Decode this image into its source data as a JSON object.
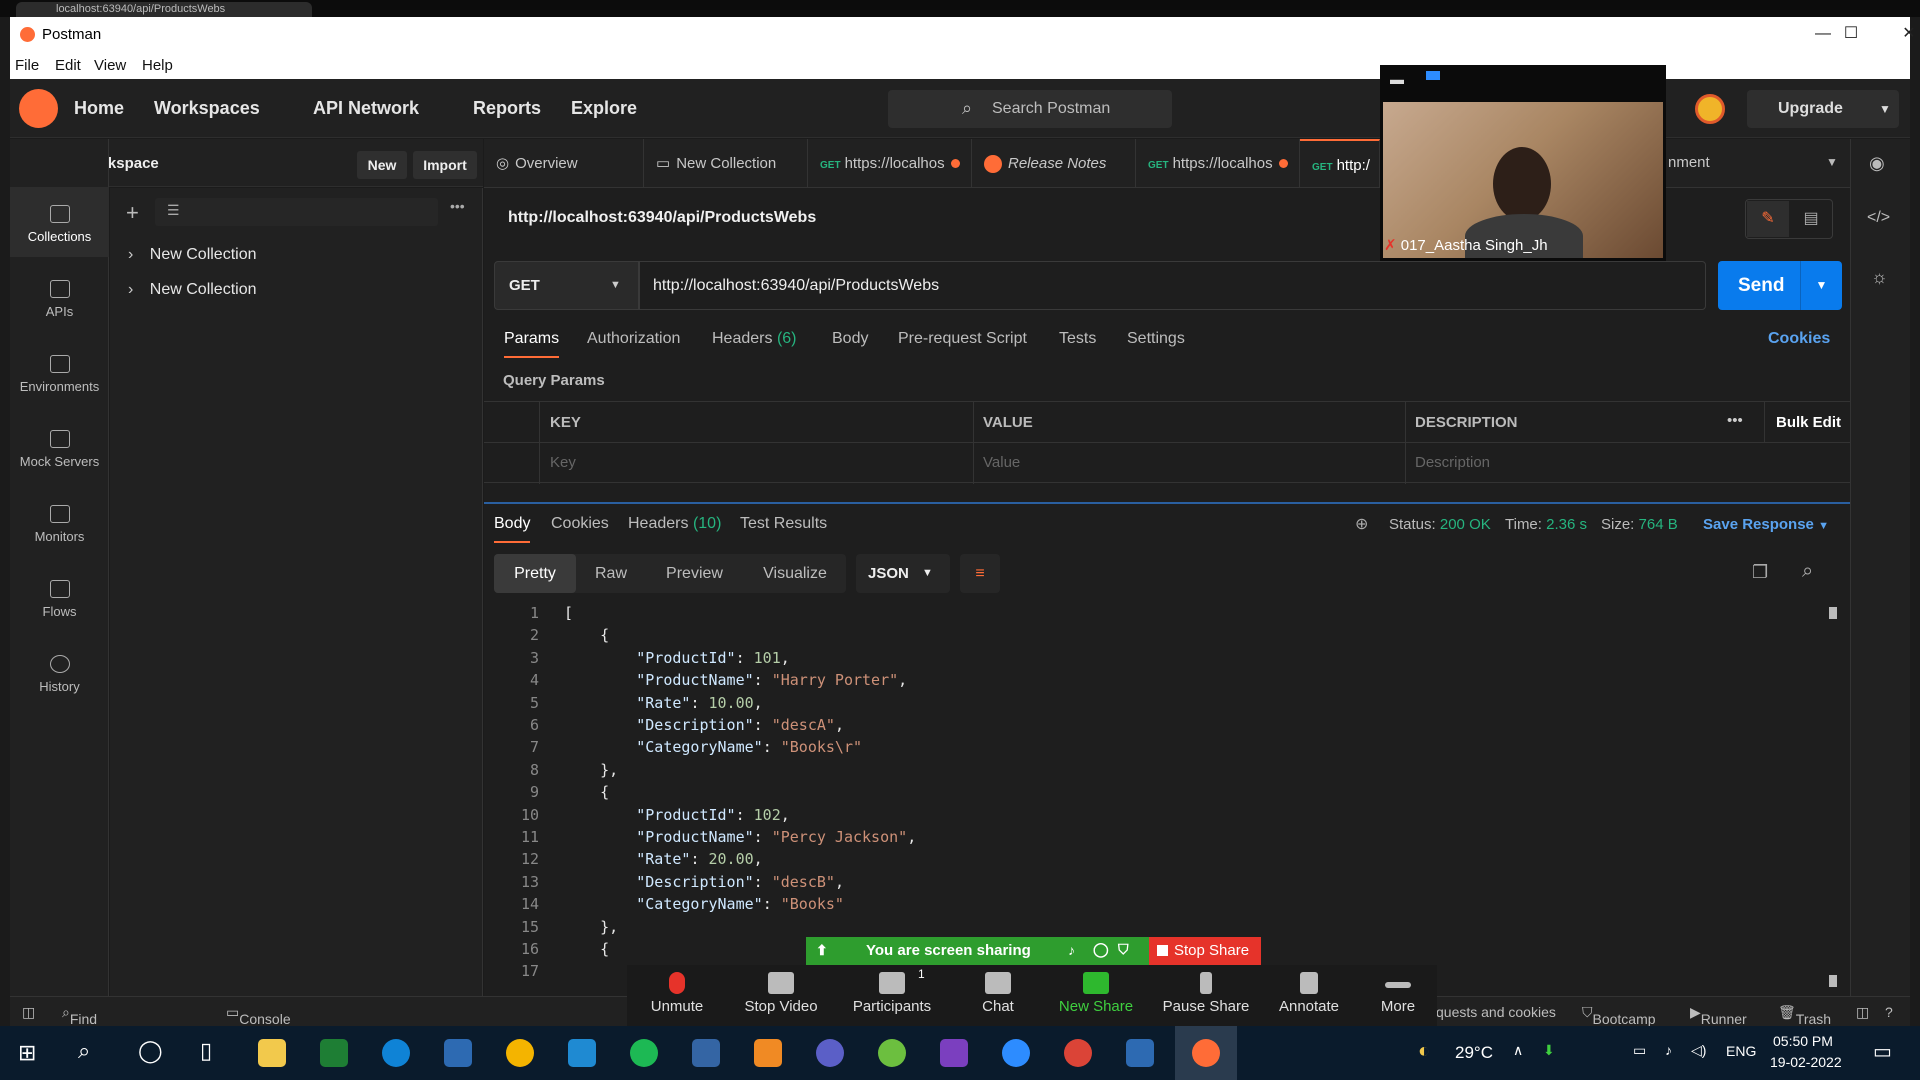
{
  "window": {
    "title": "Postman",
    "browser_tab": "localhost:63940/api/ProductsWebs"
  },
  "menu": [
    "File",
    "Edit",
    "View",
    "Help"
  ],
  "header": {
    "nav": [
      "Home",
      "Workspaces",
      "API Network",
      "Reports",
      "Explore"
    ],
    "search_placeholder": "Search Postman",
    "upgrade": "Upgrade"
  },
  "workspace": {
    "name": "My Workspace",
    "new_label": "New",
    "import_label": "Import"
  },
  "sidebar": [
    "Collections",
    "APIs",
    "Environments",
    "Mock Servers",
    "Monitors",
    "Flows",
    "History"
  ],
  "collections": [
    "New Collection",
    "New Collection"
  ],
  "tabs": [
    {
      "label": "Overview"
    },
    {
      "label": "New Collection"
    },
    {
      "method": "GET",
      "label": "https://localhos"
    },
    {
      "label": "Release Notes"
    },
    {
      "method": "GET",
      "label": "https://localhos"
    },
    {
      "method": "GET",
      "label": "http:/"
    }
  ],
  "tab_overflow_label": "nment",
  "request": {
    "title": "http://localhost:63940/api/ProductsWebs",
    "method": "GET",
    "url": "http://localhost:63940/api/ProductsWebs",
    "send": "Send",
    "tabs": [
      "Params",
      "Authorization",
      "Headers",
      "Body",
      "Pre-request Script",
      "Tests",
      "Settings"
    ],
    "headers_count": "(6)",
    "cookies": "Cookies",
    "query_params_label": "Query Params",
    "columns": [
      "KEY",
      "VALUE",
      "DESCRIPTION"
    ],
    "placeholders": [
      "Key",
      "Value",
      "Description"
    ],
    "bulk_edit": "Bulk Edit"
  },
  "response": {
    "tabs": [
      "Body",
      "Cookies",
      "Headers",
      "Test Results"
    ],
    "headers_count": "(10)",
    "status_label": "Status:",
    "status": "200 OK",
    "time_label": "Time:",
    "time": "2.36 s",
    "size_label": "Size:",
    "size": "764 B",
    "save": "Save Response",
    "formats": [
      "Pretty",
      "Raw",
      "Preview",
      "Visualize"
    ],
    "lang": "JSON"
  },
  "code_lines": [
    {
      "n": "1",
      "t": "["
    },
    {
      "n": "2",
      "t": "    {"
    },
    {
      "n": "3",
      "k": "\"ProductId\"",
      "v": "101",
      "vt": "n"
    },
    {
      "n": "4",
      "k": "\"ProductName\"",
      "v": "\"Harry Porter\"",
      "vt": "s"
    },
    {
      "n": "5",
      "k": "\"Rate\"",
      "v": "10.00",
      "vt": "n"
    },
    {
      "n": "6",
      "k": "\"Description\"",
      "v": "\"descA\"",
      "vt": "s"
    },
    {
      "n": "7",
      "k": "\"CategoryName\"",
      "v": "\"Books\\r\"",
      "vt": "s",
      "last": true
    },
    {
      "n": "8",
      "t": "    },"
    },
    {
      "n": "9",
      "t": "    {"
    },
    {
      "n": "10",
      "k": "\"ProductId\"",
      "v": "102",
      "vt": "n"
    },
    {
      "n": "11",
      "k": "\"ProductName\"",
      "v": "\"Percy Jackson\"",
      "vt": "s"
    },
    {
      "n": "12",
      "k": "\"Rate\"",
      "v": "20.00",
      "vt": "n"
    },
    {
      "n": "13",
      "k": "\"Description\"",
      "v": "\"descB\"",
      "vt": "s"
    },
    {
      "n": "14",
      "k": "\"CategoryName\"",
      "v": "\"Books\"",
      "vt": "s",
      "last": true
    },
    {
      "n": "15",
      "t": "    },"
    },
    {
      "n": "16",
      "t": "    {"
    },
    {
      "n": "17",
      "t": ""
    }
  ],
  "statusbar": {
    "find": "Find and Replace",
    "console": "Console",
    "cookies": "quests and cookies",
    "bootcamp": "Bootcamp",
    "runner": "Runner",
    "trash": "Trash"
  },
  "zoom": {
    "participant": "017_Aastha Singh_Jh",
    "sharing": "You are screen sharing",
    "stop_share": "Stop Share",
    "participants_count": "1",
    "buttons": [
      "Unmute",
      "Stop Video",
      "Participants",
      "Chat",
      "New Share",
      "Pause Share",
      "Annotate",
      "More"
    ]
  },
  "taskbar": {
    "temp": "29°C",
    "lang": "ENG",
    "time": "05:50 PM",
    "date": "19-02-2022"
  },
  "colors": {
    "accent": "#ff6c37",
    "send": "#097bed",
    "get": "#26b47f",
    "status_ok": "#26b47f"
  }
}
